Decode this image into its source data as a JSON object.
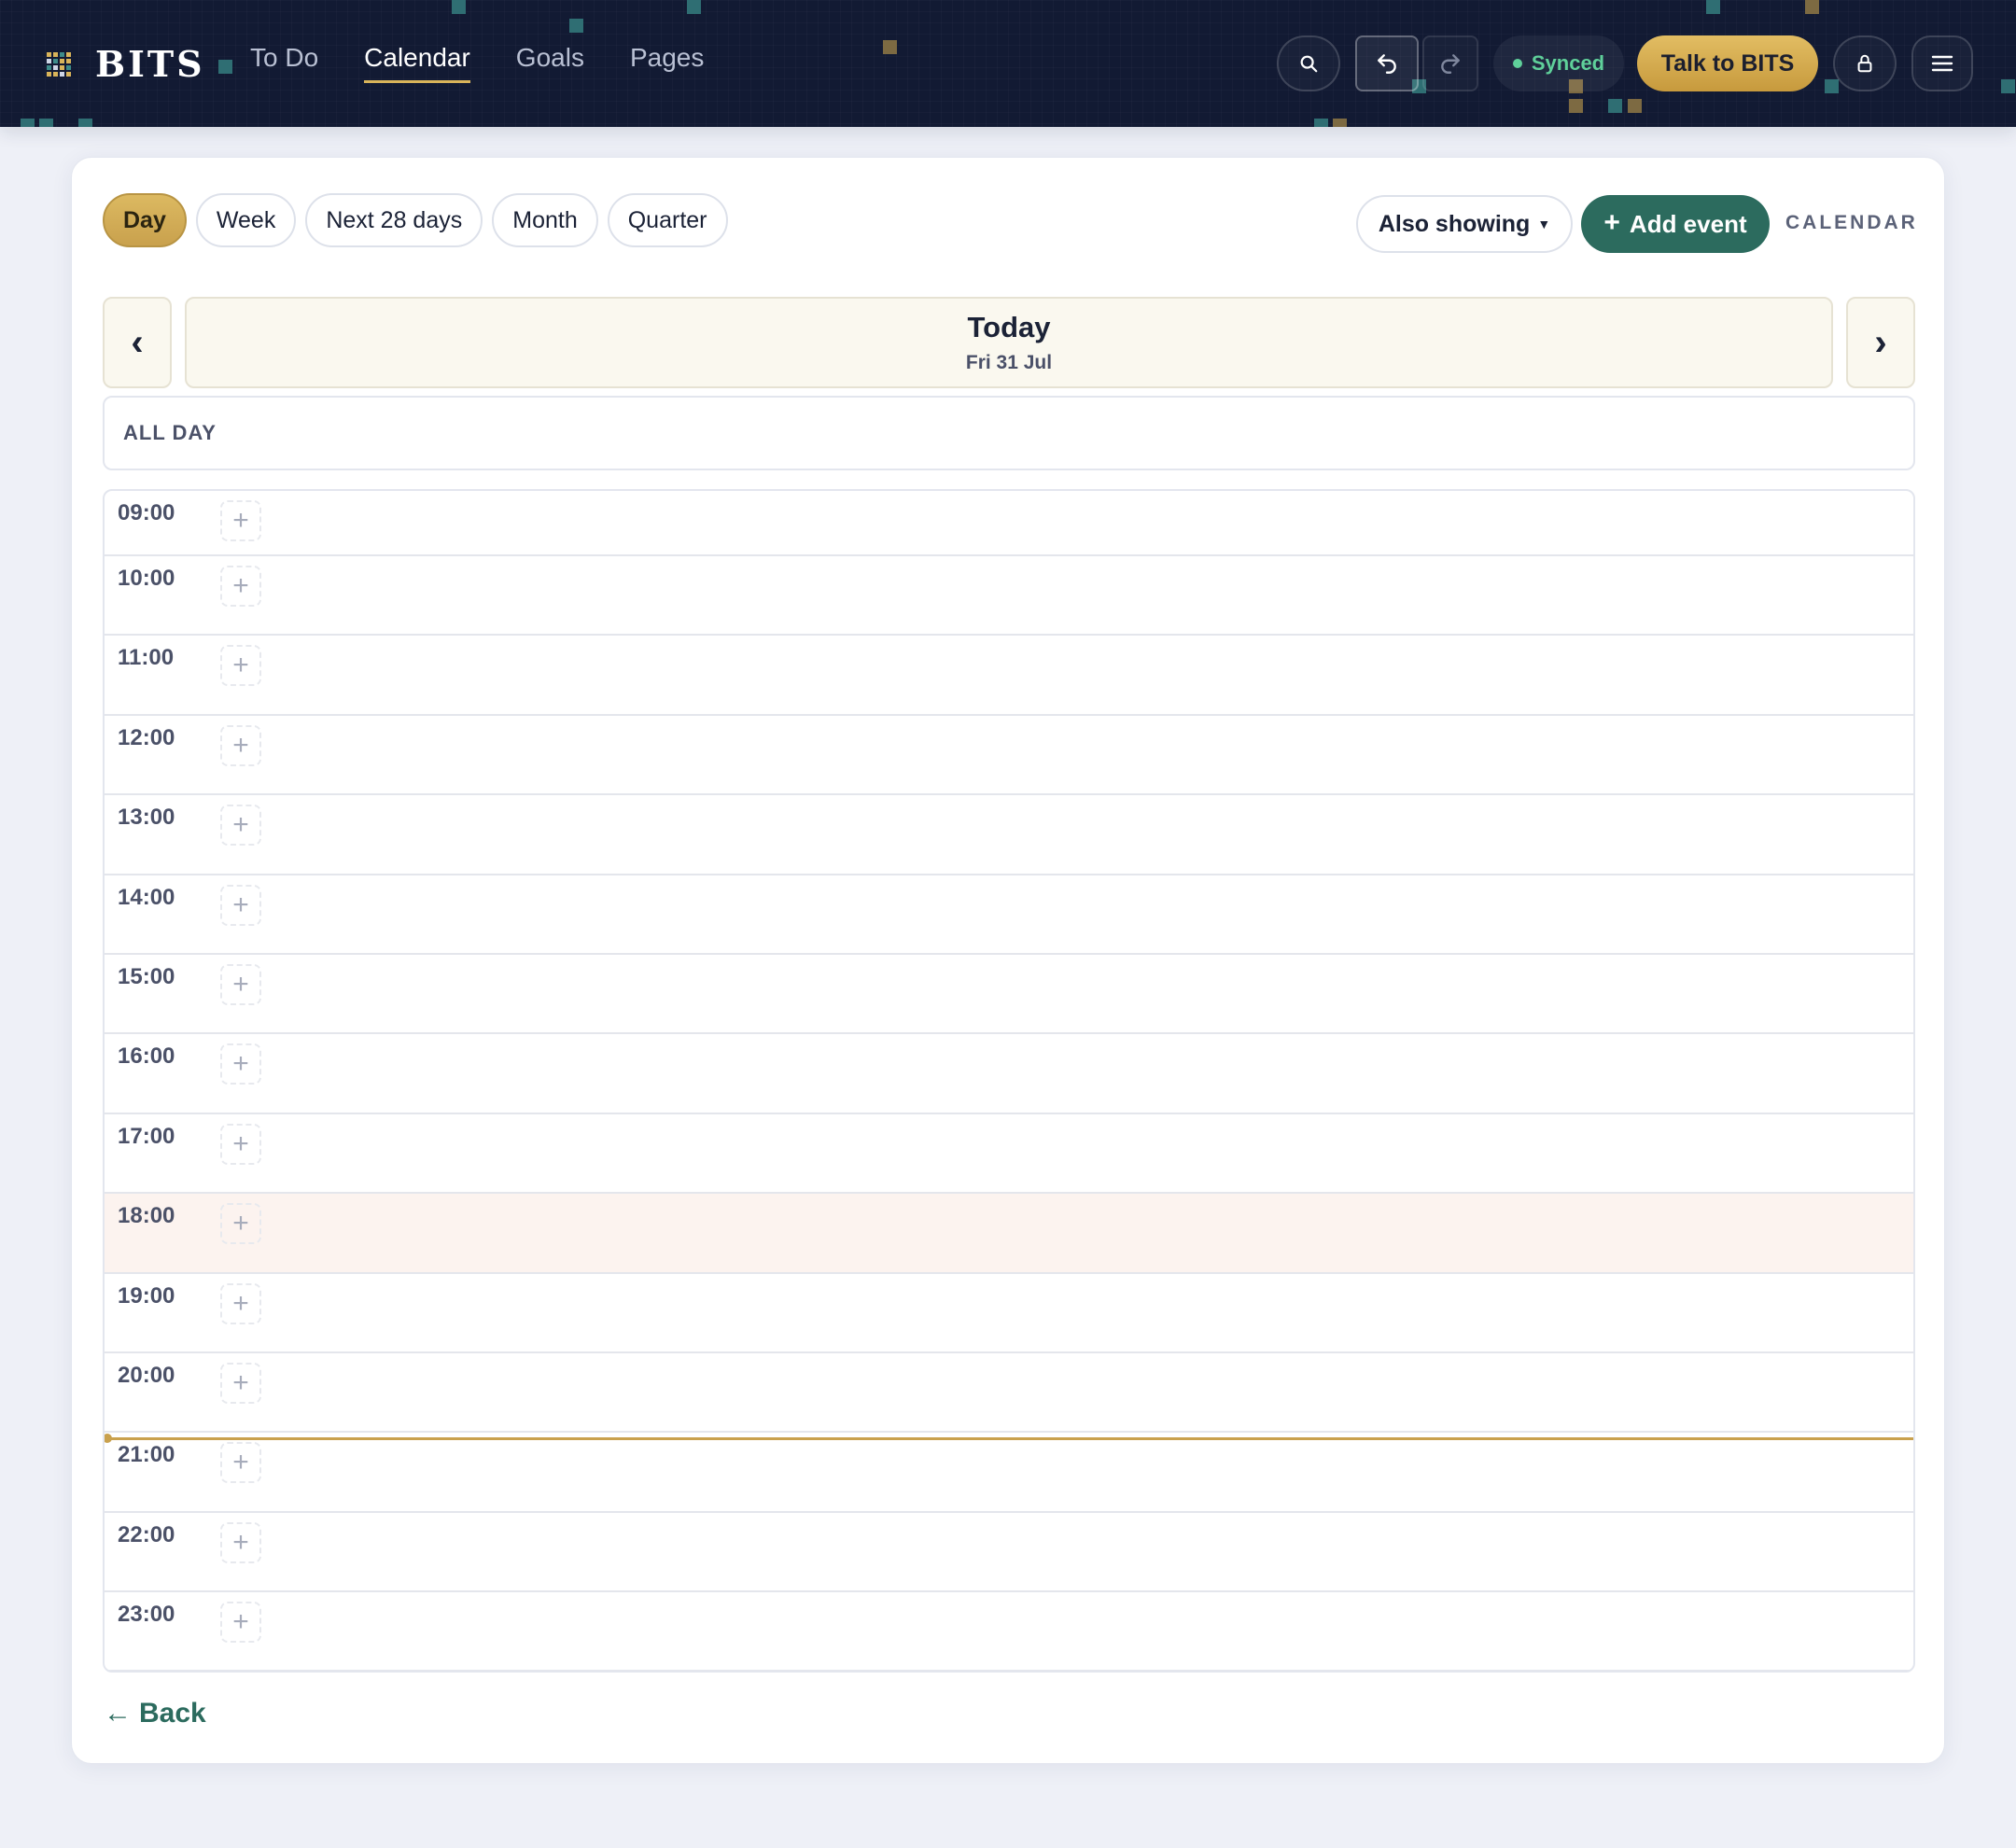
{
  "app": {
    "name": "BITS"
  },
  "nav": {
    "items": [
      "To Do",
      "Calendar",
      "Goals",
      "Pages"
    ],
    "active": "Calendar"
  },
  "header": {
    "sync_status": "Synced",
    "talk_button": "Talk to BITS"
  },
  "calendar": {
    "view_tabs": [
      "Day",
      "Week",
      "Next 28 days",
      "Month",
      "Quarter"
    ],
    "active_view": "Day",
    "also_showing": "Also showing",
    "add_event": "Add event",
    "label": "CALENDAR",
    "date_title": "Today",
    "date_subtitle": "Fri 31 Jul",
    "all_day_label": "ALL DAY",
    "hours": [
      "09:00",
      "10:00",
      "11:00",
      "12:00",
      "13:00",
      "14:00",
      "15:00",
      "16:00",
      "17:00",
      "18:00",
      "19:00",
      "20:00",
      "21:00",
      "22:00",
      "23:00"
    ],
    "current_hour": "18:00"
  },
  "footer": {
    "back_label": "Back"
  },
  "colors": {
    "accent_gold": "#c9a14d",
    "accent_green": "#2c6b5e",
    "header_bg": "#121a33"
  }
}
